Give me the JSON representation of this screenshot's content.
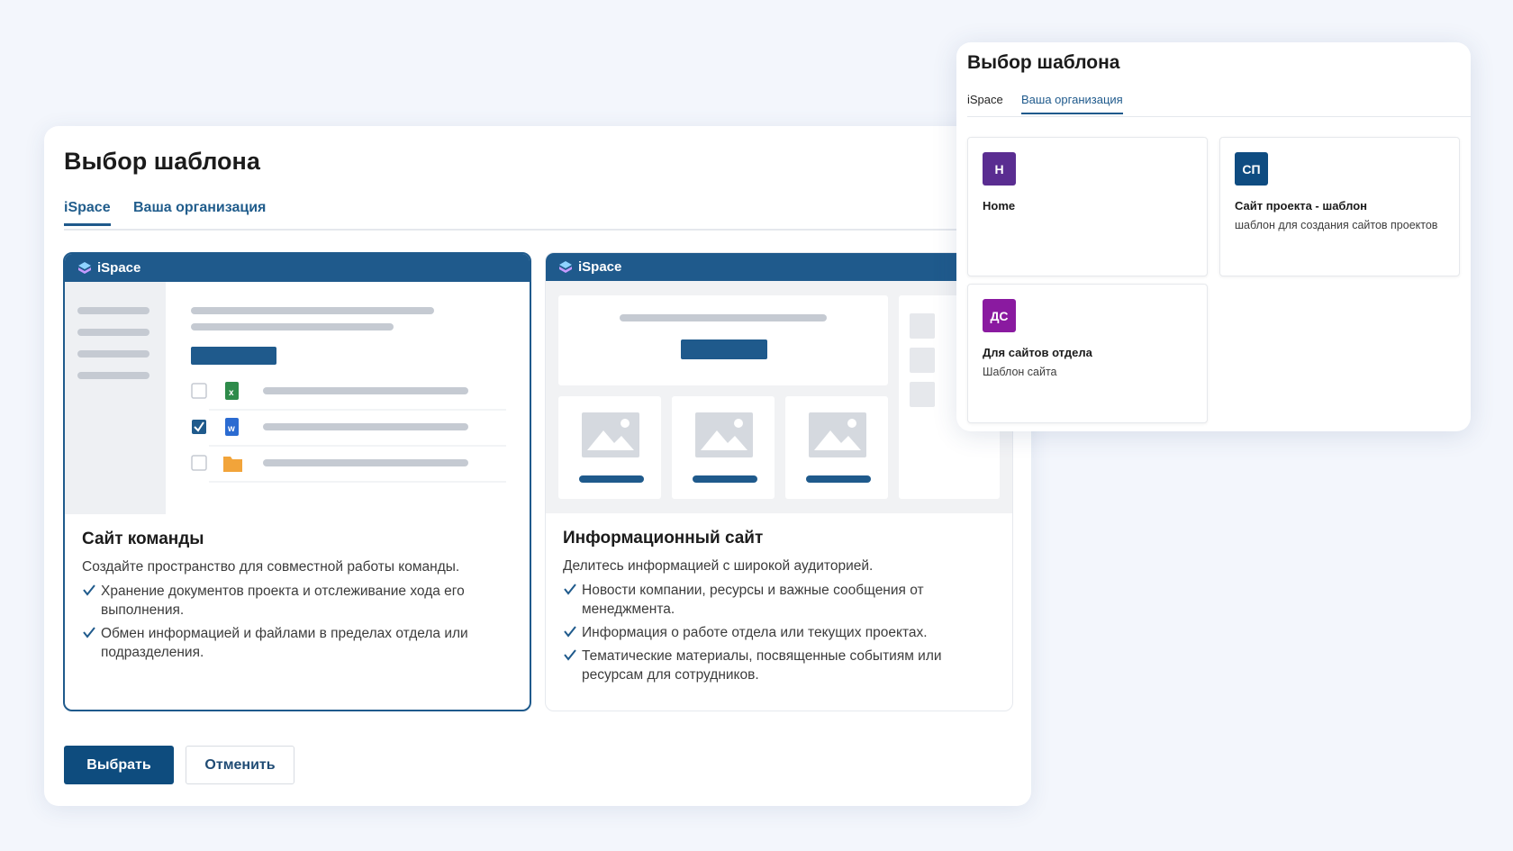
{
  "main_dialog": {
    "title": "Выбор шаблона",
    "tabs": [
      {
        "label": "iSpace",
        "active": true
      },
      {
        "label": "Ваша организация",
        "active": false
      }
    ],
    "cards": [
      {
        "brand": "iSpace",
        "title": "Сайт команды",
        "description": "Создайте пространство для совместной работы команды.",
        "bullets": [
          "Хранение документов проекта и отслеживание хода его выполнения.",
          "Обмен информацией и файлами в пределах отдела или подразделения."
        ],
        "selected": true,
        "preview_icons": [
          "excel-file-icon",
          "word-file-icon",
          "folder-icon"
        ]
      },
      {
        "brand": "iSpace",
        "title": "Информационный сайт",
        "description": "Делитесь информацией с широкой аудиторией.",
        "bullets": [
          "Новости компании, ресурсы и важные сообщения от менеджмента.",
          "Информация о работе отдела или текущих проектах.",
          "Тематические материалы, посвященные событиям или ресурсам для сотрудников."
        ],
        "selected": false
      }
    ],
    "buttons": {
      "select": "Выбрать",
      "cancel": "Отменить"
    }
  },
  "overlay_dialog": {
    "title": "Выбор шаблона",
    "tabs": [
      {
        "label": "iSpace",
        "active": false
      },
      {
        "label": "Ваша организация",
        "active": true
      }
    ],
    "templates": [
      {
        "initials": "Н",
        "title": "Home",
        "description": "",
        "color": "#5a2d91"
      },
      {
        "initials": "СП",
        "title": "Сайт проекта - шаблон",
        "description": "шаблон для создания сайтов проектов",
        "color": "#0f4c81"
      },
      {
        "initials": "ДС",
        "title": "Для сайтов отдела",
        "description": "Шаблон сайта",
        "color": "#8a1aa0"
      }
    ]
  },
  "colors": {
    "accent": "#1f5a8c",
    "primary_button": "#0e4c7e",
    "page_background": "#f3f6fc"
  }
}
